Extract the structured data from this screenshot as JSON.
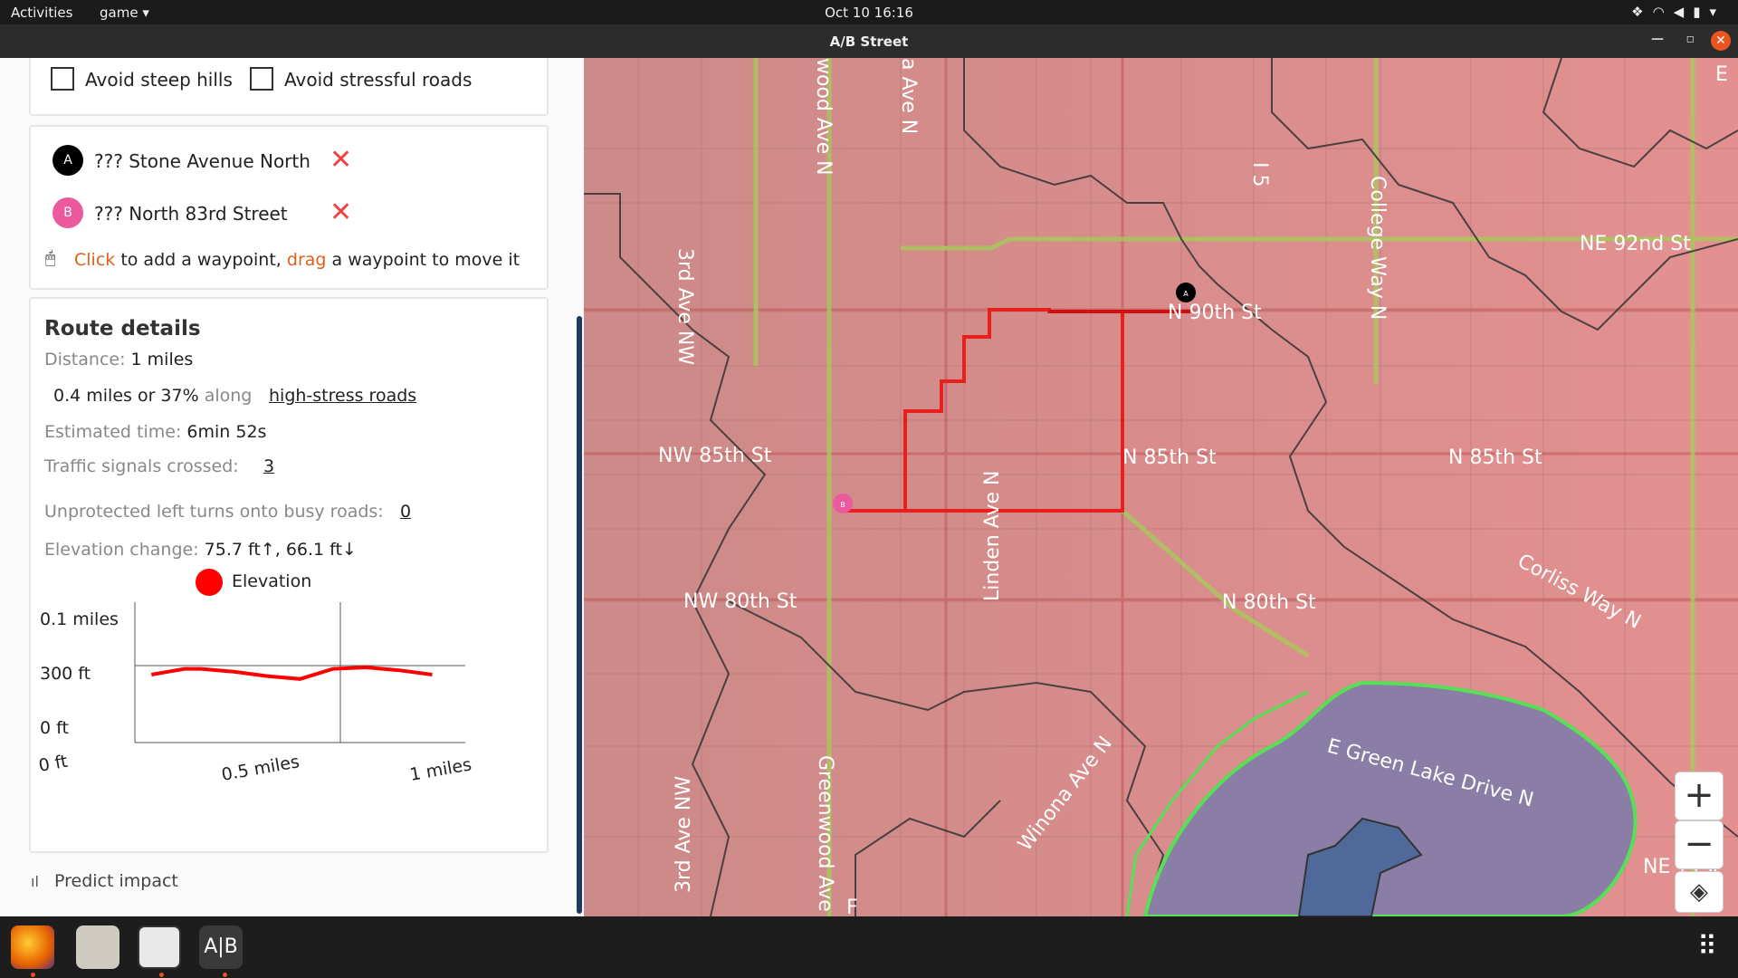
{
  "topbar": {
    "activities": "Activities",
    "app_menu": "game ▾",
    "clock": "Oct 10  16:16"
  },
  "window": {
    "title": "A/B Street"
  },
  "options": {
    "avoid_hills": "Avoid steep hills",
    "avoid_stressful": "Avoid stressful roads"
  },
  "waypoints": {
    "a_marker": "A",
    "a_name": "??? Stone Avenue North",
    "b_marker": "B",
    "b_name": "??? North 83rd Street",
    "help_click": "Click",
    "help_mid": " to add a waypoint, ",
    "help_drag": "drag",
    "help_end": " a waypoint to move it"
  },
  "route": {
    "heading": "Route details",
    "distance_label": "Distance:",
    "distance_value": "1 miles",
    "stress_value": "0.4 miles or 37%",
    "stress_along": "along",
    "stress_link": "high-stress roads",
    "time_label": "Estimated time:",
    "time_value": "6min 52s",
    "signals_label": "Traffic signals crossed:",
    "signals_value": "3",
    "left_label": "Unprotected left turns onto busy roads:",
    "left_value": "0",
    "elev_label": "Elevation change:",
    "elev_value": "75.7 ft↑, 66.1 ft↓",
    "legend": "Elevation"
  },
  "chart_data": {
    "type": "line",
    "series": [
      {
        "name": "Elevation",
        "x": [
          0.05,
          0.1,
          0.15,
          0.2,
          0.3,
          0.4,
          0.5,
          0.6,
          0.7,
          0.8,
          0.9
        ],
        "values": [
          300,
          302,
          304,
          304,
          302,
          299,
          297,
          304,
          305,
          303,
          300
        ]
      }
    ],
    "y_tick_labels": [
      "0.1 miles",
      "300 ft",
      "0 ft"
    ],
    "x_tick_labels": [
      "0 ft",
      "0.5 miles",
      "1 miles"
    ],
    "colors": {
      "line": "#ff0000"
    }
  },
  "predict": {
    "label": "Predict impact"
  },
  "map": {
    "labels": {
      "n90": "N 90th St",
      "ne92": "NE 92nd St",
      "nw85": "NW 85th St",
      "n85a": "N 85th St",
      "n85b": "N 85th St",
      "nw80": "NW 80th St",
      "n80": "N 80th St",
      "ave3a": "3rd Ave NW",
      "ave3b": "3rd Ave NW",
      "greenwood": "Greenwood Ave",
      "greenwood_top": "wood Ave N",
      "linden": "Linden Ave N",
      "college": "College Way N",
      "i5": "I 5",
      "winona": "Winona Ave N",
      "corliss": "Corliss Way N",
      "green_lake": "E Green Lake Drive N",
      "aave": "a Ave N",
      "ne_partial": "NE 71st",
      "e_partial": "E",
      "f_partial": "F"
    },
    "marker_a": "A",
    "marker_b": "B",
    "zoom_in": "+",
    "zoom_out": "−"
  }
}
